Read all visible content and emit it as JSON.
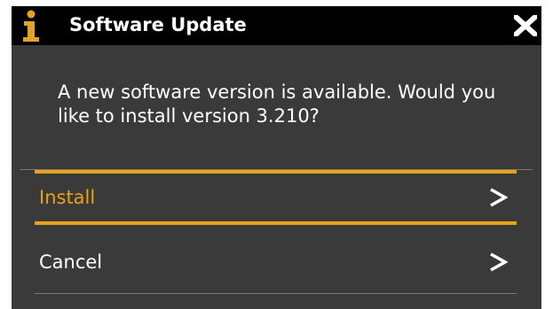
{
  "dialog": {
    "title": "Software Update",
    "message": "A new software version is available. Would you like to install version 3.210?",
    "icons": {
      "title_icon": "info-icon",
      "close": "close-icon",
      "item_arrow": "chevron-right-icon"
    },
    "menu": [
      {
        "label": "Install",
        "selected": true
      },
      {
        "label": "Cancel",
        "selected": false
      }
    ],
    "colors": {
      "titlebar_bg": "#000000",
      "body_bg": "#3a3a3a",
      "accent": "#e8a317",
      "text": "#ffffff"
    }
  }
}
